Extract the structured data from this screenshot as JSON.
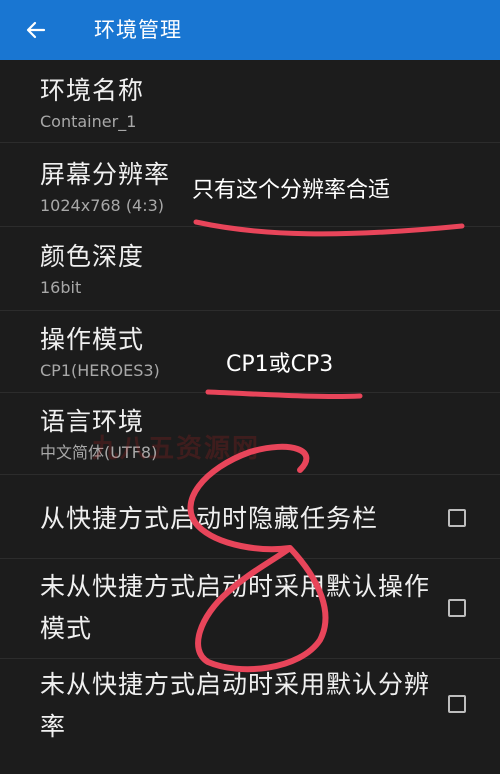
{
  "appbar": {
    "title": "环境管理",
    "back_icon": "arrow-left-icon",
    "color": "#1976d2"
  },
  "settings": [
    {
      "title": "环境名称",
      "value": "Container_1"
    },
    {
      "title": "屏幕分辨率",
      "value": "1024x768 (4:3)"
    },
    {
      "title": "颜色深度",
      "value": "16bit"
    },
    {
      "title": "操作模式",
      "value": "CP1(HEROES3)"
    },
    {
      "title": "语言环境",
      "value": "中文简体(UTF8)"
    }
  ],
  "checkboxes": [
    {
      "label": "从快捷方式启动时隐藏任务栏",
      "checked": false
    },
    {
      "label": "未从快捷方式启动时采用默认操作模式",
      "checked": false
    },
    {
      "label": "未从快捷方式启动时采用默认分辨率",
      "checked": false
    }
  ],
  "annotations": {
    "resolution_note": "只有这个分辨率合适",
    "mode_note": "CP1或CP3",
    "ink_color": "#e8455a"
  },
  "watermark": "九八五资源网"
}
